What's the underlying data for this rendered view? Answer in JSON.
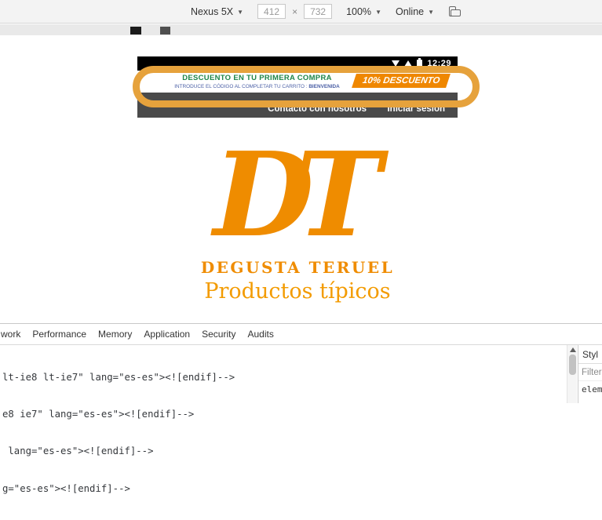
{
  "device_toolbar": {
    "device_label": "Nexus 5X",
    "width_value": "412",
    "separator": "×",
    "height_value": "732",
    "zoom_label": "100%",
    "network_label": "Online"
  },
  "phone": {
    "status_time": "12:29",
    "promo": {
      "line1": "DESCUENTO EN TU PRIMERA COMPRA",
      "line2_prefix": "INTRODUCE EL CÓDIGO AL COMPLETAR TU CARRITO : ",
      "line2_code": "BIENVENIDA",
      "badge_label": "10% DESCUENTO"
    },
    "nav": {
      "contact_label": "Contacto con nosotros",
      "login_label": "Iniciar sesión"
    },
    "logo": {
      "monogram": "DT",
      "title": "DEGUSTA TERUEL",
      "subtitle": "Productos típicos"
    },
    "colors": {
      "accent_orange": "#ef8c00",
      "promo_green": "#1d8549",
      "promo_blue": "#4a5fa5",
      "badge_orange": "#ef8700",
      "nav_gray": "#4a4a4a",
      "highlight_ring": "#e6a23c"
    }
  },
  "devtools": {
    "tabs": [
      "work",
      "Performance",
      "Memory",
      "Application",
      "Security",
      "Audits"
    ],
    "source_lines": [
      "lt-ie8 lt-ie7\" lang=\"es-es\"><![endif]-->",
      "e8 ie7\" lang=\"es-es\"><![endif]-->",
      " lang=\"es-es\"><![endif]-->",
      "g=\"es-es\"><![endif]-->"
    ],
    "styles_pane": {
      "tab_label": "Styl",
      "filter_label": "Filter",
      "element_label": "elem"
    }
  }
}
